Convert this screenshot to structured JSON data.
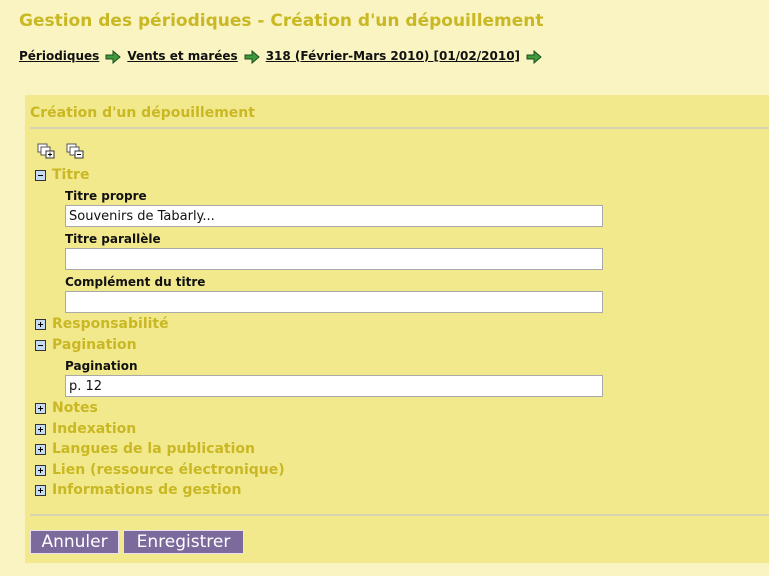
{
  "page": {
    "title": "Gestion des périodiques - Création d'un dépouillement"
  },
  "breadcrumb": {
    "items": [
      {
        "label": "Périodiques"
      },
      {
        "label": "Vents et marées"
      },
      {
        "label": "318 (Février-Mars 2010) [01/02/2010]"
      }
    ]
  },
  "form": {
    "title": "Création d'un dépouillement",
    "toolbar": {
      "expand_all_icon": "expand-all-icon",
      "collapse_all_icon": "collapse-all-icon"
    },
    "sections": {
      "titre": {
        "label": "Titre",
        "state": "expanded",
        "fields": {
          "titre_propre": {
            "label": "Titre propre",
            "value": "Souvenirs de Tabarly..."
          },
          "titre_parallele": {
            "label": "Titre parallèle",
            "value": ""
          },
          "complement": {
            "label": "Complément du titre",
            "value": ""
          }
        }
      },
      "responsabilite": {
        "label": "Responsabilité",
        "state": "collapsed"
      },
      "pagination": {
        "label": "Pagination",
        "state": "expanded",
        "fields": {
          "pagination": {
            "label": "Pagination",
            "value": "p. 12"
          }
        }
      },
      "notes": {
        "label": "Notes",
        "state": "collapsed"
      },
      "indexation": {
        "label": "Indexation",
        "state": "collapsed"
      },
      "langues": {
        "label": "Langues de la publication",
        "state": "collapsed"
      },
      "lien": {
        "label": "Lien (ressource électronique)",
        "state": "collapsed"
      },
      "gestion": {
        "label": "Informations de gestion",
        "state": "collapsed"
      }
    },
    "buttons": {
      "cancel": "Annuler",
      "save": "Enregistrer"
    }
  },
  "colors": {
    "background": "#f9f4c1",
    "panel": "#f2e98d",
    "heading": "#c9b824",
    "button": "#7d6a9c"
  }
}
